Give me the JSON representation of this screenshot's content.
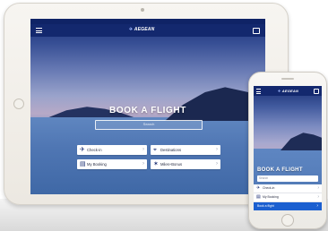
{
  "brand": {
    "name": "AEGEAN",
    "mark": "✈"
  },
  "tablet": {
    "title": "BOOK A FLIGHT",
    "search_placeholder": "Search",
    "tiles": [
      {
        "icon": "plane-icon",
        "glyph": "✈",
        "label": "Check-in"
      },
      {
        "icon": "map-pin-icon",
        "glyph": "⌖",
        "label": "Destinations"
      },
      {
        "icon": "ticket-icon",
        "glyph": "▤",
        "label": "My Booking"
      },
      {
        "icon": "star-icon",
        "glyph": "✶",
        "label": "Miles+Bonus"
      }
    ]
  },
  "phone": {
    "title": "BOOK A FLIGHT",
    "search_placeholder": "Search",
    "rows": [
      {
        "icon": "plane-icon",
        "glyph": "✈",
        "label": "Check-in"
      },
      {
        "icon": "ticket-icon",
        "glyph": "▤",
        "label": "My Booking"
      }
    ],
    "cta": {
      "label": "Book a flight"
    }
  },
  "colors": {
    "navbar": "#13286e",
    "accent": "#1b5fd0",
    "device_frame": "#f2f0eb"
  }
}
